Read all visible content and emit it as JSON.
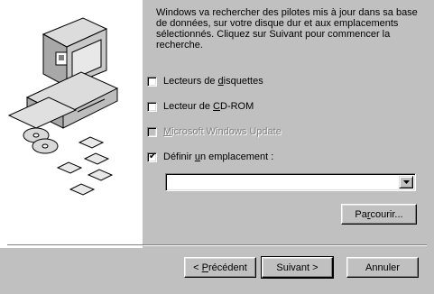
{
  "intro_text": "Windows va rechercher des pilotes mis à jour dans sa base de données, sur votre disque dur et aux emplacements sélectionnés. Cliquez sur Suivant pour commencer la recherche.",
  "options": [
    {
      "label_pre": "Lecteurs de ",
      "accel": "d",
      "label_post": "isquettes",
      "checked": false,
      "enabled": true
    },
    {
      "label_pre": "Lecteur de ",
      "accel": "C",
      "label_post": "D-ROM",
      "checked": false,
      "enabled": true
    },
    {
      "label_pre": "",
      "accel": "M",
      "label_post": "icrosoft Windows Update",
      "checked": false,
      "enabled": false
    },
    {
      "label_pre": "Définir ",
      "accel": "u",
      "label_post": "n emplacement :",
      "checked": true,
      "enabled": true
    }
  ],
  "location_value": "",
  "browse_button": {
    "pre": "Pa",
    "accel": "r",
    "post": "courir..."
  },
  "back_button": {
    "pre": "< ",
    "accel": "P",
    "post": "récédent"
  },
  "next_button": {
    "label": "Suivant >"
  },
  "cancel_button": {
    "label": "Annuler"
  },
  "check_mark": "✔",
  "colors": {
    "panel": "#c0c0c0",
    "art_background": "#ffffff",
    "disabled_text": "#808080"
  }
}
